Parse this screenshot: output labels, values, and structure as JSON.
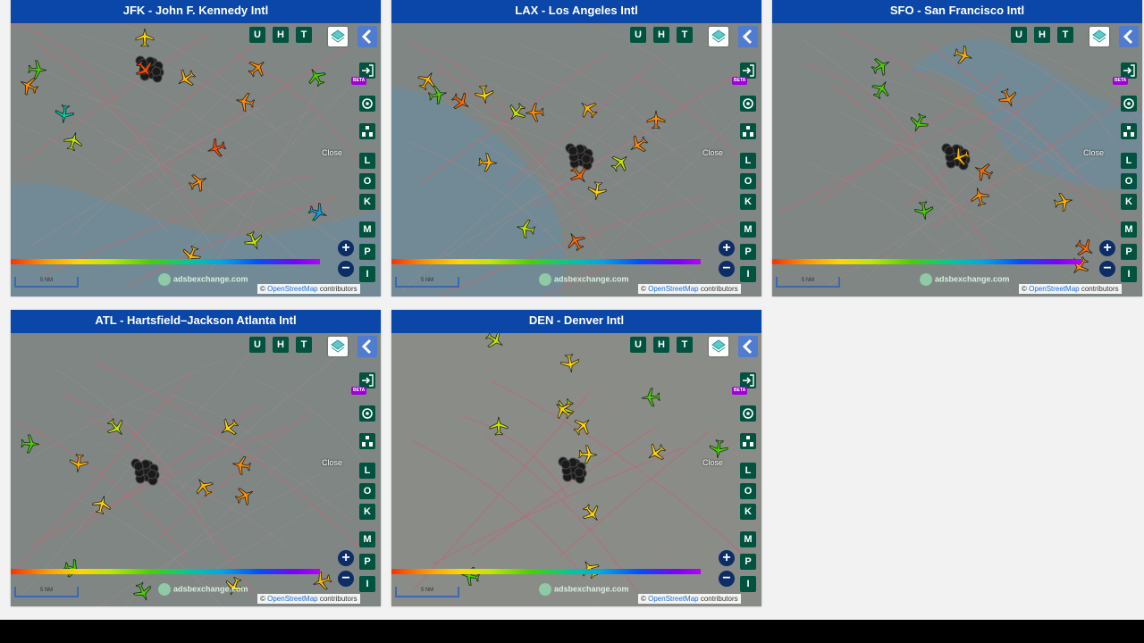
{
  "panels": [
    {
      "id": "jfk",
      "title": "JFK - John F. Kennedy Intl",
      "dots": [
        {
          "c": "#ffd500"
        },
        {
          "c": "#ff8c00"
        },
        {
          "c": "#47d100"
        },
        {
          "c": "#ff4a00"
        },
        {
          "c": "#00c8a0"
        },
        {
          "c": "#ffb300"
        },
        {
          "c": "#ff8c00"
        },
        {
          "c": "#47d100"
        },
        {
          "c": "#c2e600"
        },
        {
          "c": "#ff8c00"
        },
        {
          "c": "#00a7e6"
        },
        {
          "c": "#c2e600"
        },
        {
          "c": "#ffb300"
        },
        {
          "c": "#ff4a00"
        },
        {
          "c": "#ff8c00"
        }
      ]
    },
    {
      "id": "lax",
      "title": "LAX - Los Angeles Intl",
      "dots": [
        {
          "c": "#ffb300"
        },
        {
          "c": "#47d100"
        },
        {
          "c": "#ff6a00"
        },
        {
          "c": "#ffd500"
        },
        {
          "c": "#c2e600"
        },
        {
          "c": "#ff8c00"
        },
        {
          "c": "#ffb300"
        },
        {
          "c": "#ff8c00"
        },
        {
          "c": "#c2e600"
        },
        {
          "c": "#ffb300"
        },
        {
          "c": "#ff6a00"
        },
        {
          "c": "#ffd500"
        },
        {
          "c": "#ff8c00"
        },
        {
          "c": "#c2e600"
        },
        {
          "c": "#ff6a00"
        }
      ]
    },
    {
      "id": "sfo",
      "title": "SFO - San Francisco Intl",
      "dots": [
        {
          "c": "#47d100"
        },
        {
          "c": "#ffb300"
        },
        {
          "c": "#ff8c00"
        },
        {
          "c": "#47d100"
        },
        {
          "c": "#ffb300"
        },
        {
          "c": "#ff6a00"
        },
        {
          "c": "#ff8c00"
        },
        {
          "c": "#47d100"
        },
        {
          "c": "#ffb300"
        },
        {
          "c": "#ff6a00"
        },
        {
          "c": "#47d100"
        },
        {
          "c": "#ff8c00"
        }
      ]
    },
    {
      "id": "atl",
      "title": "ATL - Hartsfield–Jackson Atlanta Intl",
      "dots": [
        {
          "c": "#47d100"
        },
        {
          "c": "#c2e600"
        },
        {
          "c": "#ffb300"
        },
        {
          "c": "#ffd500"
        },
        {
          "c": "#ff8c00"
        },
        {
          "c": "#ffb300"
        },
        {
          "c": "#ffd500"
        },
        {
          "c": "#ff8c00"
        },
        {
          "c": "#47d100"
        },
        {
          "c": "#47d100"
        },
        {
          "c": "#ffd500"
        },
        {
          "c": "#ffb300"
        }
      ]
    },
    {
      "id": "den",
      "title": "DEN - Denver Intl",
      "dots": [
        {
          "c": "#c2e600"
        },
        {
          "c": "#ffd500"
        },
        {
          "c": "#c2e600"
        },
        {
          "c": "#47d100"
        },
        {
          "c": "#ffd500"
        },
        {
          "c": "#c2e600"
        },
        {
          "c": "#ffd500"
        },
        {
          "c": "#ffd500"
        },
        {
          "c": "#ffd500"
        },
        {
          "c": "#47d100"
        },
        {
          "c": "#ffd500"
        },
        {
          "c": "#47d100"
        },
        {
          "c": "#ffd500"
        }
      ]
    }
  ],
  "controls": {
    "top": [
      "U",
      "H",
      "T"
    ],
    "side": [
      "L",
      "O",
      "K"
    ],
    "side2": [
      "M",
      "P",
      "I"
    ],
    "zoom_in": "+",
    "zoom_out": "−",
    "close_label": "Close",
    "beta_label": "BETA",
    "scale_label": "5 NM",
    "watermark": "adsbexchange.com",
    "attrib_prefix": "© ",
    "attrib_link": "OpenStreetMap",
    "attrib_suffix": " contributors",
    "altitude_ticks": [
      "",
      "",
      "",
      "",
      "",
      "",
      "",
      "",
      "",
      "",
      ""
    ]
  },
  "colors": {
    "header": "#0a47a8",
    "control": "#00533f",
    "accent": "#4f7bd0",
    "zoom": "#0d2d66"
  }
}
